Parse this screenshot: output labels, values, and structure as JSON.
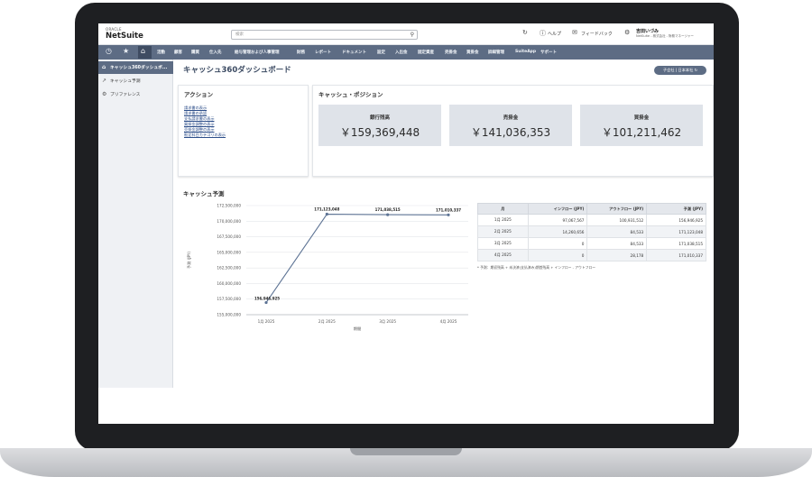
{
  "header": {
    "logo_oracle": "ORACLE",
    "logo_netsuite": "NetSuite",
    "search_placeholder": "検索",
    "help_label": "ヘルプ",
    "feedback_label": "フィードバック",
    "user_name": "吉田いづみ",
    "user_role": "NetSuite - 株式会社 - 財務マネージャー"
  },
  "nav": {
    "items": [
      "活動",
      "顧客",
      "購買",
      "仕入先",
      "給与管理および人事管理",
      "財務",
      "レポート",
      "ドキュメント",
      "設定",
      "入出金",
      "固定資産",
      "売掛金",
      "買掛金",
      "詳細管理",
      "SuiteApp",
      "サポート"
    ]
  },
  "sidebar": {
    "items": [
      {
        "label": "キャッシュ360ダッシュボ...",
        "icon": "dashboard-icon"
      },
      {
        "label": "キャッシュ予測",
        "icon": "chart-icon"
      },
      {
        "label": "プリファレンス",
        "icon": "settings-icon"
      }
    ]
  },
  "page": {
    "title": "キャッシュ360ダッシュボード",
    "org_pill": "子会社 | 日本本社"
  },
  "actions": {
    "title": "アクション",
    "links": [
      "請求書の表示",
      "請求書の承認",
      "支払請求書の表示",
      "買掛金調整の表示",
      "売掛金調整の表示",
      "勘定科目カテゴリの表示"
    ]
  },
  "position": {
    "title": "キャッシュ・ポジション",
    "kpis": [
      {
        "label": "銀行残高",
        "value": "￥159,369,448"
      },
      {
        "label": "売掛金",
        "value": "￥141,036,353"
      },
      {
        "label": "買掛金",
        "value": "￥101,211,462"
      }
    ]
  },
  "forecast": {
    "title": "キャッシュ予測",
    "table": {
      "headers": [
        "月",
        "インフロー (JPY)",
        "アウトフロー (JPY)",
        "予測 (JPY)"
      ],
      "rows": [
        [
          "1月 2025",
          "97,067,567",
          "100,931,512",
          "156,946,925"
        ],
        [
          "2月 2025",
          "14,260,656",
          "84,533",
          "171,123,048"
        ],
        [
          "3月 2025",
          "0",
          "84,533",
          "171,038,515"
        ],
        [
          "4月 2025",
          "0",
          "28,178",
          "171,010,337"
        ]
      ]
    },
    "note": "* 予測：期初残高 + 未決済(支払済み)期首残高 + インフロー - アウトフロー"
  },
  "chart_data": {
    "type": "line",
    "title": "",
    "xlabel": "期間",
    "ylabel": "予測 (JPY)",
    "categories": [
      "1月 2025",
      "2月 2025",
      "3月 2025",
      "4月 2025"
    ],
    "yticks": [
      "172,500,000",
      "170,000,000",
      "167,500,000",
      "165,000,000",
      "162,500,000",
      "160,000,000",
      "157,500,000",
      "155,000,000"
    ],
    "ylim": [
      155000000,
      172500000
    ],
    "series": [
      {
        "values": [
          156946925,
          171123048,
          171038515,
          171010337
        ],
        "labels": [
          "156,946,925",
          "171,123,048",
          "171,038,515",
          "171,010,337"
        ],
        "color": "#5d7394"
      }
    ],
    "grid": true
  },
  "colors": {
    "nav": "#5d6c84",
    "accent": "#3b4a62",
    "line": "#5d7394"
  }
}
